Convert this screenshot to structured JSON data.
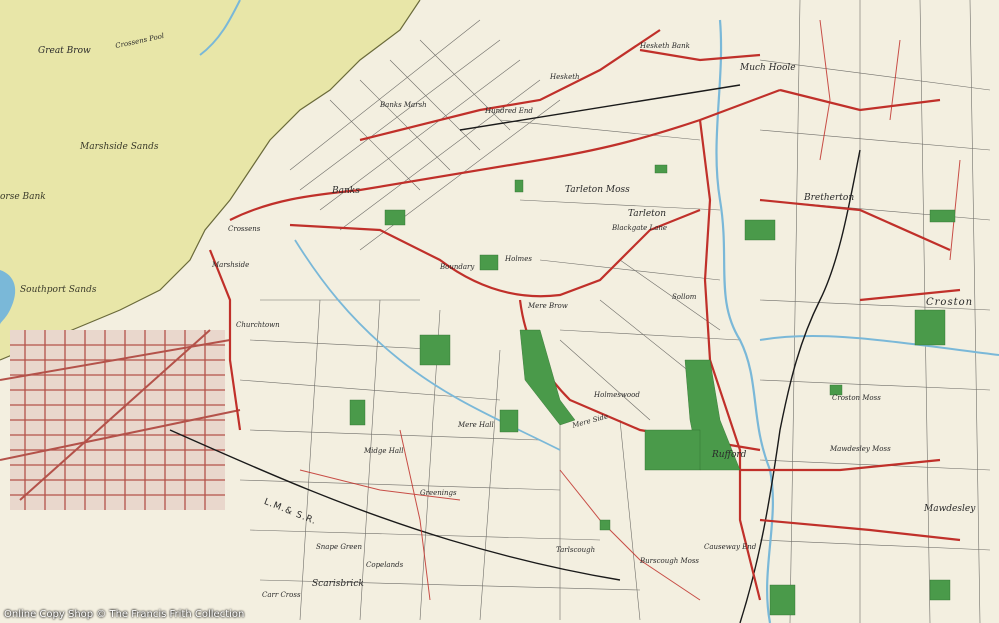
{
  "map": {
    "labels": {
      "great_brow": "Great Brow",
      "crossens_pool": "Crossens Pool",
      "banks_marsh": "Banks Marsh",
      "hundred_end": "Hundred End",
      "marshside_sands": "Marshside Sands",
      "horse_bank": "orse Bank",
      "southport_sands": "Southport Sands",
      "banks": "Banks",
      "crossens": "Crossens",
      "marshside": "Marshside",
      "churchtown": "Churchtown",
      "boundary": "Boundary",
      "holmes": "Holmes",
      "mere_brow": "Mere Brow",
      "hesketh": "Hesketh",
      "hesketh_bank": "Hesketh Bank",
      "tarleton_moss": "Tarleton Moss",
      "tarleton": "Tarleton",
      "much_hoole": "Much Hoole",
      "bretherton": "Bretherton",
      "croston": "Croston",
      "croston_moss": "Croston Moss",
      "sollom": "Sollom",
      "holmeswood": "Holmeswood",
      "mere_side": "Mere Side",
      "rufford": "Rufford",
      "mawdesley_moss": "Mawdesley Moss",
      "mawdesley": "Mawdesley",
      "blackgate_lane": "Blackgate Lane",
      "greenings": "Greenings",
      "scarisbrick": "Scarisbrick",
      "tarlscough": "Tarlscough",
      "burscough_moss": "Burscough Moss",
      "causeway_end": "Causeway End",
      "carr_cross": "Carr Cross",
      "snape_green": "Snape Green",
      "copelands": "Copelands",
      "midge_hall": "Midge Hall",
      "mere_hall": "Mere Hall",
      "lmsr": "L.M.& S.R."
    },
    "colors": {
      "sand": "#e8e6a8",
      "land": "#f3efe0",
      "roads": "#c0302a",
      "water": "#7ab8d8",
      "woods": "#4a9a4a",
      "urban": "#b4524a"
    }
  },
  "copyright": "Online Copy Shop  © The Francis Frith Collection"
}
